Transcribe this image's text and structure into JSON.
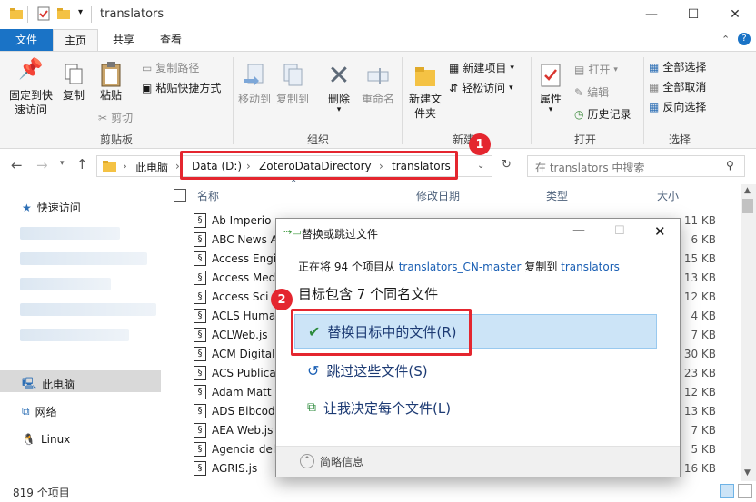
{
  "window": {
    "title": "translators",
    "controls": [
      "—",
      "☐",
      "✕"
    ]
  },
  "ribbon": {
    "tabs": [
      "文件",
      "主页",
      "共享",
      "查看"
    ],
    "clipboard": {
      "pin": "固定到快速访问",
      "copy": "复制",
      "paste": "粘贴",
      "copy_path": "复制路径",
      "paste_shortcut": "粘贴快捷方式",
      "cut": "剪切",
      "label": "剪贴板"
    },
    "organize": {
      "move_to": "移动到",
      "copy_to": "复制到",
      "delete": "删除",
      "rename": "重命名",
      "label": "组织"
    },
    "new": {
      "new_folder": "新建文件夹",
      "new_item": "新建项目",
      "easy_access": "轻松访问",
      "label": "新建"
    },
    "open": {
      "properties": "属性",
      "open": "打开",
      "edit": "编辑",
      "history": "历史记录",
      "label": "打开"
    },
    "select": {
      "select_all": "全部选择",
      "select_none": "全部取消",
      "invert": "反向选择",
      "label": "选择"
    }
  },
  "address": {
    "root": "此电脑",
    "crumbs": [
      "Data (D:)",
      "ZoteroDataDirectory",
      "translators"
    ],
    "search_placeholder": "在 translators 中搜索"
  },
  "nav": {
    "quick_access": "快速访问",
    "this_pc": "此电脑",
    "network": "网络",
    "linux": "Linux"
  },
  "columns": {
    "name": "名称",
    "modified": "修改日期",
    "type": "类型",
    "size": "大小"
  },
  "files": [
    {
      "name": "Ab Imperio",
      "size": "11 KB"
    },
    {
      "name": "ABC News A",
      "size": "6 KB"
    },
    {
      "name": "Access Engi",
      "size": "15 KB"
    },
    {
      "name": "Access Med",
      "size": "13 KB"
    },
    {
      "name": "Access Sci",
      "size": "12 KB"
    },
    {
      "name": "ACLS Huma",
      "size": "4 KB"
    },
    {
      "name": "ACLWeb.js",
      "size": "7 KB"
    },
    {
      "name": "ACM Digital",
      "size": "30 KB"
    },
    {
      "name": "ACS Publica",
      "size": "23 KB"
    },
    {
      "name": "Adam Matt",
      "size": "12 KB"
    },
    {
      "name": "ADS Bibcod",
      "size": "13 KB"
    },
    {
      "name": "AEA Web.js",
      "size": "7 KB"
    },
    {
      "name": "Agencia del",
      "size": "5 KB"
    },
    {
      "name": "AGRIS.js",
      "size": "16 KB"
    }
  ],
  "status": {
    "count": "819 个项目"
  },
  "dialog": {
    "title": "替换或跳过文件",
    "info_prefix": "正在将 94 个项目从 ",
    "source": "translators_CN-master",
    "info_mid": " 复制到 ",
    "dest": "translators",
    "heading": "目标包含 7 个同名文件",
    "replace": "替换目标中的文件(R)",
    "skip": "跳过这些文件(S)",
    "decide": "让我决定每个文件(L)",
    "details": "简略信息"
  },
  "annotations": {
    "step1": "1",
    "step2": "2"
  },
  "colors": {
    "accent": "#1a73c6",
    "highlight": "#e4262f",
    "selected": "#cce4f7"
  }
}
